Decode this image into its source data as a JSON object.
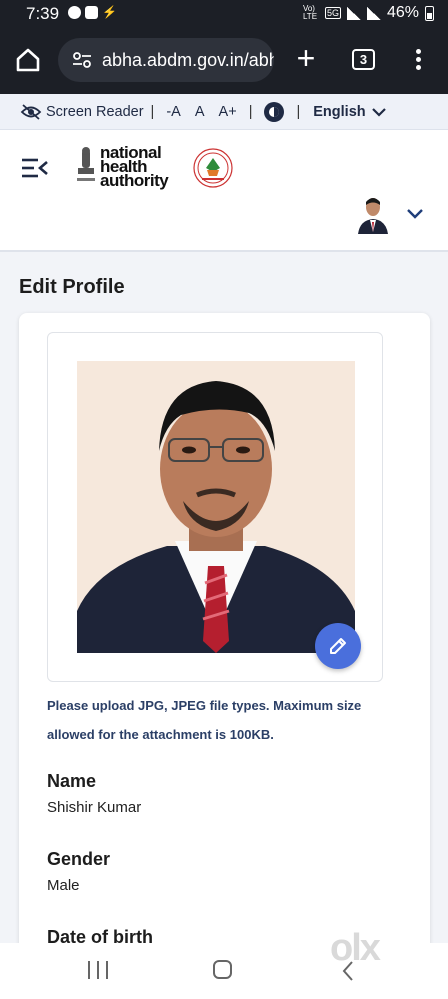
{
  "status_bar": {
    "time": "7:39",
    "battery": "46%",
    "network_5g": "5G",
    "volte": "Vo) LTE"
  },
  "browser": {
    "url": "abha.abdm.gov.in/abha",
    "tab_count": "3"
  },
  "accessibility_bar": {
    "screen_reader": "Screen Reader",
    "font_decrease": "-A",
    "font_normal": "A",
    "font_increase": "A+",
    "language": "English"
  },
  "header": {
    "logo_text_line1": "national",
    "logo_text_line2": "health",
    "logo_text_line3": "authority"
  },
  "main": {
    "title": "Edit Profile",
    "upload_hint": "Please upload JPG, JPEG file types. Maximum size allowed for the attachment is 100KB.",
    "fields": [
      {
        "label": "Name",
        "value": "Shishir Kumar"
      },
      {
        "label": "Gender",
        "value": "Male"
      },
      {
        "label": "Date of birth",
        "value": ""
      }
    ]
  },
  "watermark": "olx",
  "colors": {
    "primary": "#4a6fdc",
    "navy": "#1f2a44",
    "hint": "#2b3f66"
  }
}
